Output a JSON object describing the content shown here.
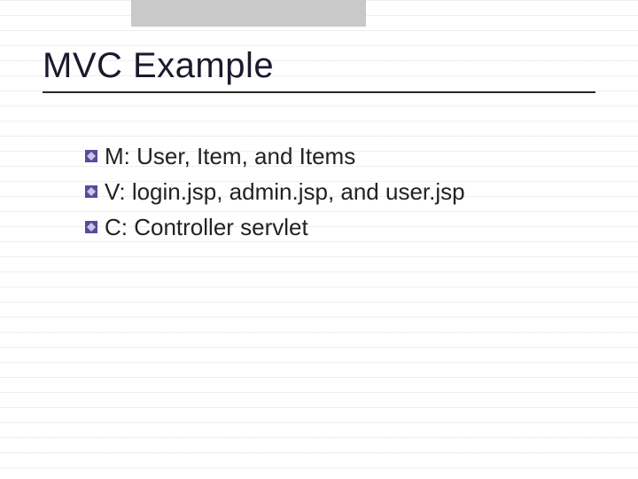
{
  "slide": {
    "title": "MVC Example",
    "bullets": [
      "M: User, Item, and Items",
      "V: login.jsp, admin.jsp, and user.jsp",
      "C: Controller servlet"
    ]
  },
  "colors": {
    "bullet_fill": "#5a4a9a",
    "bullet_diamond": "#d8ccf0"
  }
}
